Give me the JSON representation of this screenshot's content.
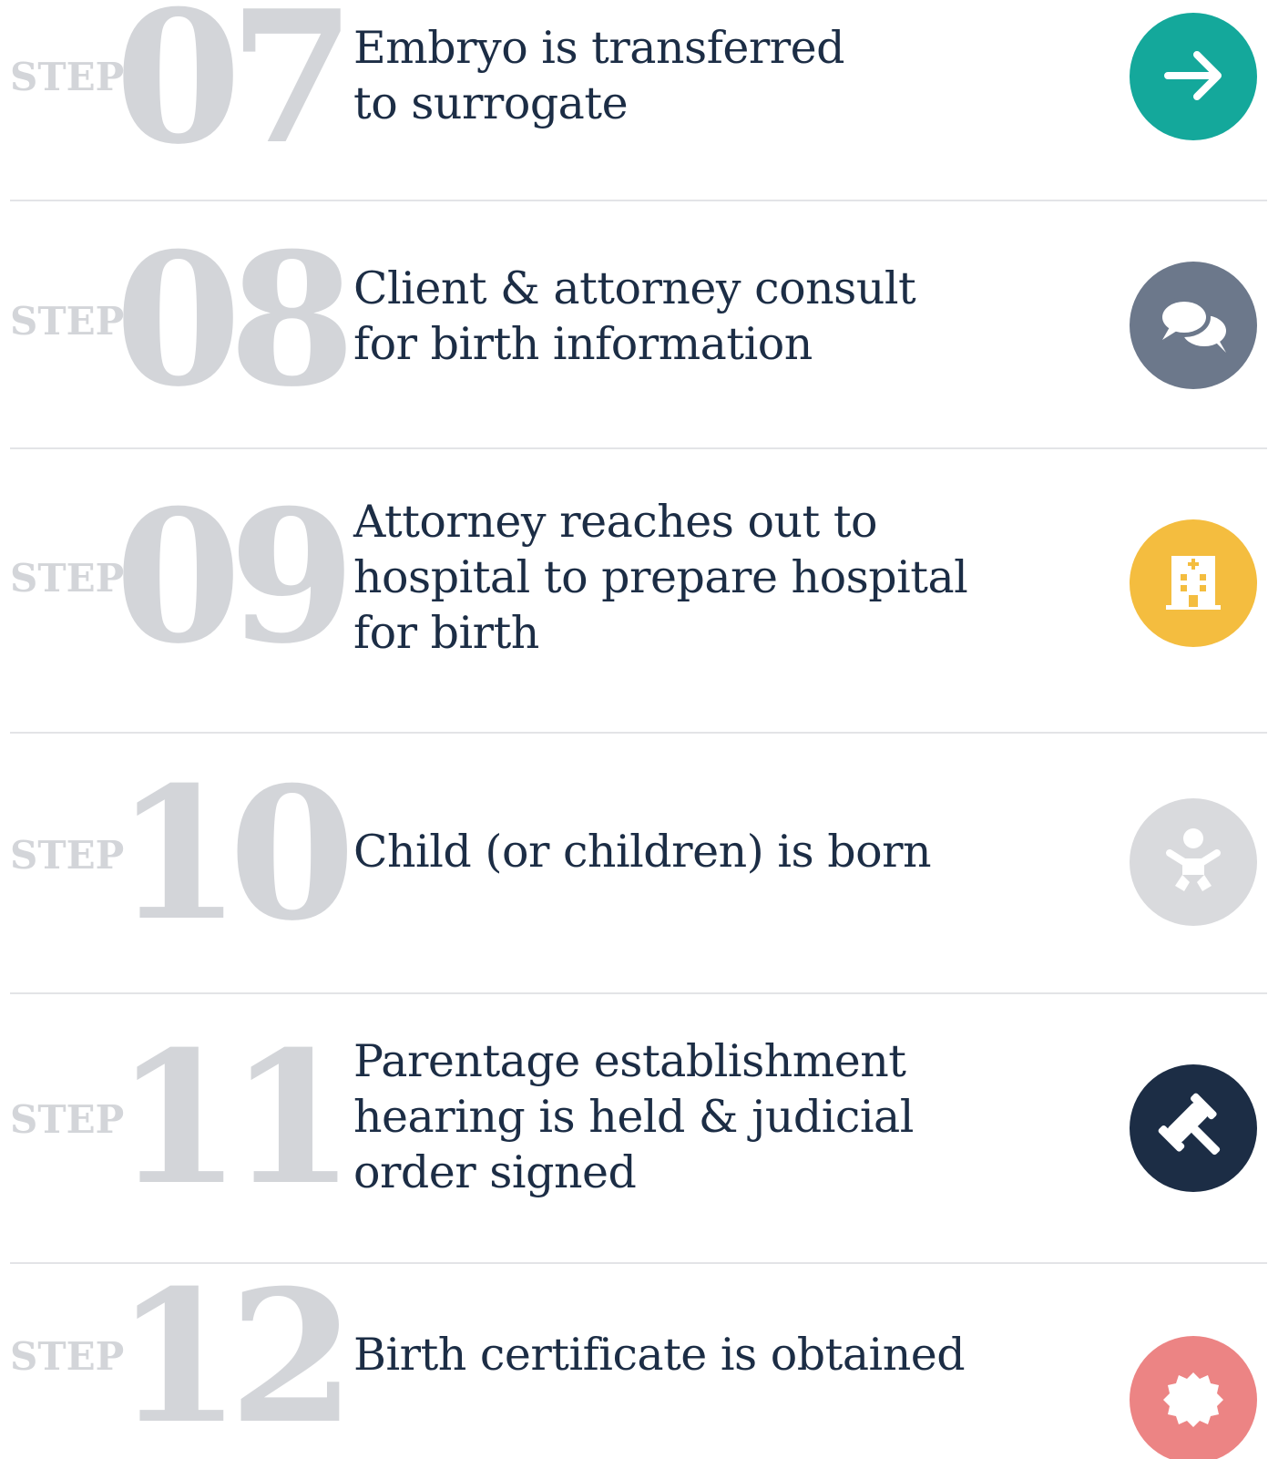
{
  "steps": [
    {
      "label": "STEP",
      "number": "07",
      "text_lines": [
        "Embryo is transferred",
        "to surrogate"
      ],
      "icon": "arrow-right-icon",
      "color": "#14a89b"
    },
    {
      "label": "STEP",
      "number": "08",
      "text_lines": [
        "Client & attorney consult",
        "for birth information"
      ],
      "icon": "chat-bubbles-icon",
      "color": "#6c788b"
    },
    {
      "label": "STEP",
      "number": "09",
      "text_lines": [
        "Attorney reaches out to",
        "hospital to prepare hospital",
        "for birth"
      ],
      "icon": "hospital-icon",
      "color": "#f4bd3f"
    },
    {
      "label": "STEP",
      "number": "10",
      "text_lines": [
        "Child (or children) is born"
      ],
      "icon": "baby-icon",
      "color": "#d9dadd"
    },
    {
      "label": "STEP",
      "number": "11",
      "text_lines": [
        "Parentage establishment",
        "hearing is held & judicial",
        "order signed"
      ],
      "icon": "gavel-icon",
      "color": "#1c2d45"
    },
    {
      "label": "STEP",
      "number": "12",
      "text_lines": [
        "Birth certificate is obtained"
      ],
      "icon": "certificate-seal-icon",
      "color": "#ec8484"
    }
  ]
}
